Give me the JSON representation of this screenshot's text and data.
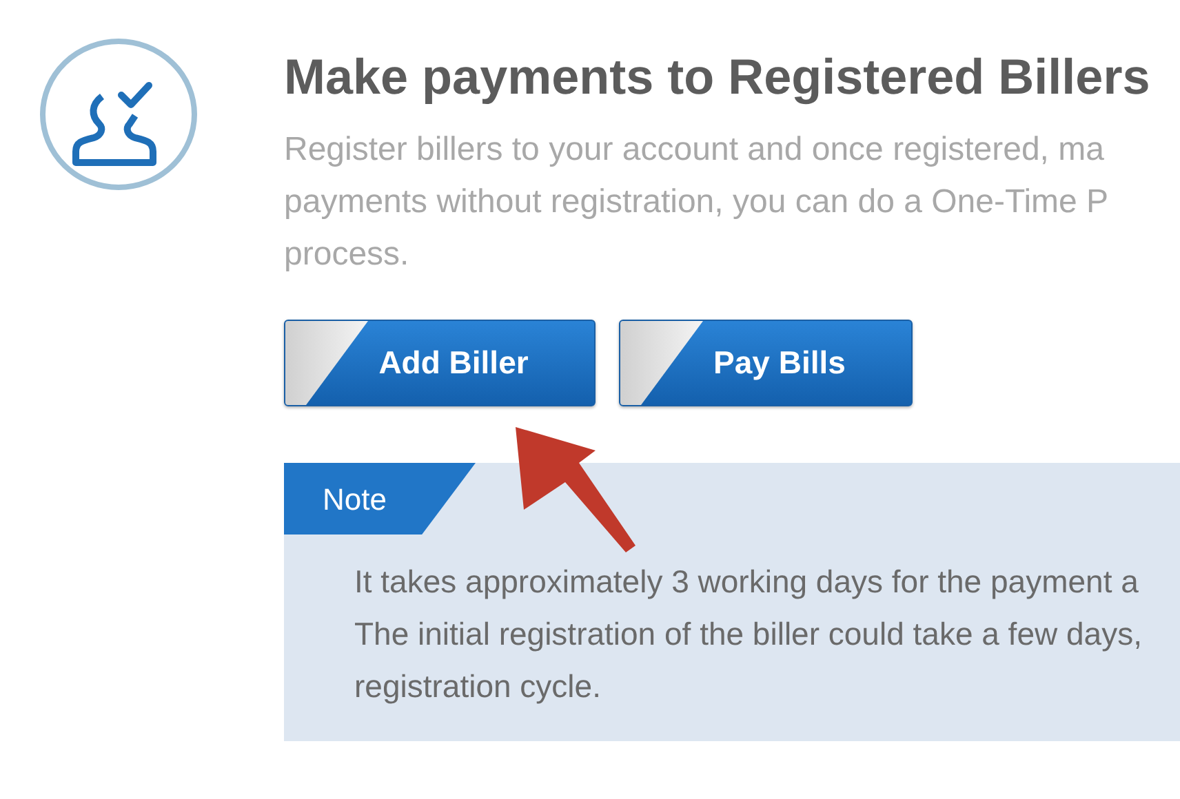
{
  "header": {
    "title": "Make payments to Registered Billers",
    "description_lines": [
      "Register billers to your account and once registered, ma",
      "payments without registration, you can do a One-Time P",
      "process."
    ]
  },
  "buttons": [
    {
      "label": "Add Biller"
    },
    {
      "label": "Pay Bills"
    }
  ],
  "note": {
    "title": "Note",
    "lines": [
      "It takes approximately 3 working days for the payment a",
      "The initial registration of the biller could take a few days,",
      "registration cycle."
    ]
  }
}
